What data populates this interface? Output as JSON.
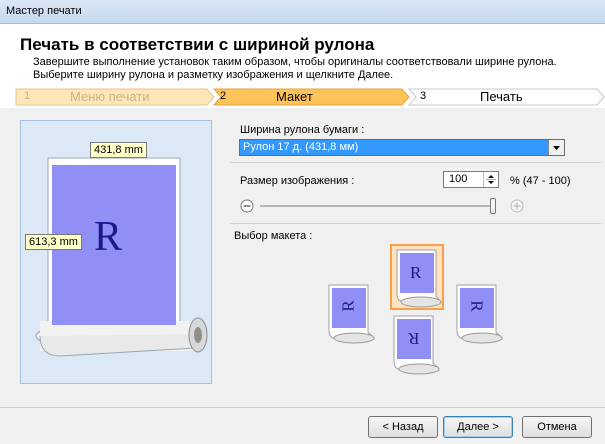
{
  "window": {
    "title": "Мастер печати"
  },
  "header": {
    "title": "Печать в соответствии с шириной рулона",
    "description_line1": "Завершите выполнение установок таким образом, чтобы оригиналы соответствовали ширине рулона.",
    "description_line2": "Выберите ширину рулона и разметку изображения и щелкните Далее."
  },
  "steps": [
    {
      "num": "1",
      "label": "Меню печати",
      "state": "done"
    },
    {
      "num": "2",
      "label": "Макет",
      "state": "active"
    },
    {
      "num": "3",
      "label": "Печать",
      "state": "pending"
    }
  ],
  "preview": {
    "width_label": "431,8 mm",
    "height_label": "613,3 mm",
    "glyph": "R"
  },
  "settings": {
    "roll_width_label": "Ширина рулона бумаги :",
    "roll_width_value": "Рулон 17 д. (431,8 мм)",
    "image_size_label": "Размер изображения :",
    "image_size_value": "100",
    "image_size_range": "% (47 - 100)",
    "image_size_percent": 100,
    "layout_label": "Выбор макета :"
  },
  "layouts": [
    {
      "name": "layout-rotate-left",
      "glyph": "R",
      "selected": false
    },
    {
      "name": "layout-normal",
      "glyph": "R",
      "selected": true
    },
    {
      "name": "layout-rotate-right",
      "glyph": "R",
      "selected": false
    },
    {
      "name": "layout-upside-down",
      "glyph": "R",
      "selected": false
    }
  ],
  "buttons": {
    "back": "< Назад",
    "next": "Далее >",
    "cancel": "Отмена"
  },
  "colors": {
    "accent": "#ffc35a",
    "page_fill": "#8f8ff5",
    "panel_bg": "#dbe9f7",
    "selected_border": "#f7a049"
  }
}
